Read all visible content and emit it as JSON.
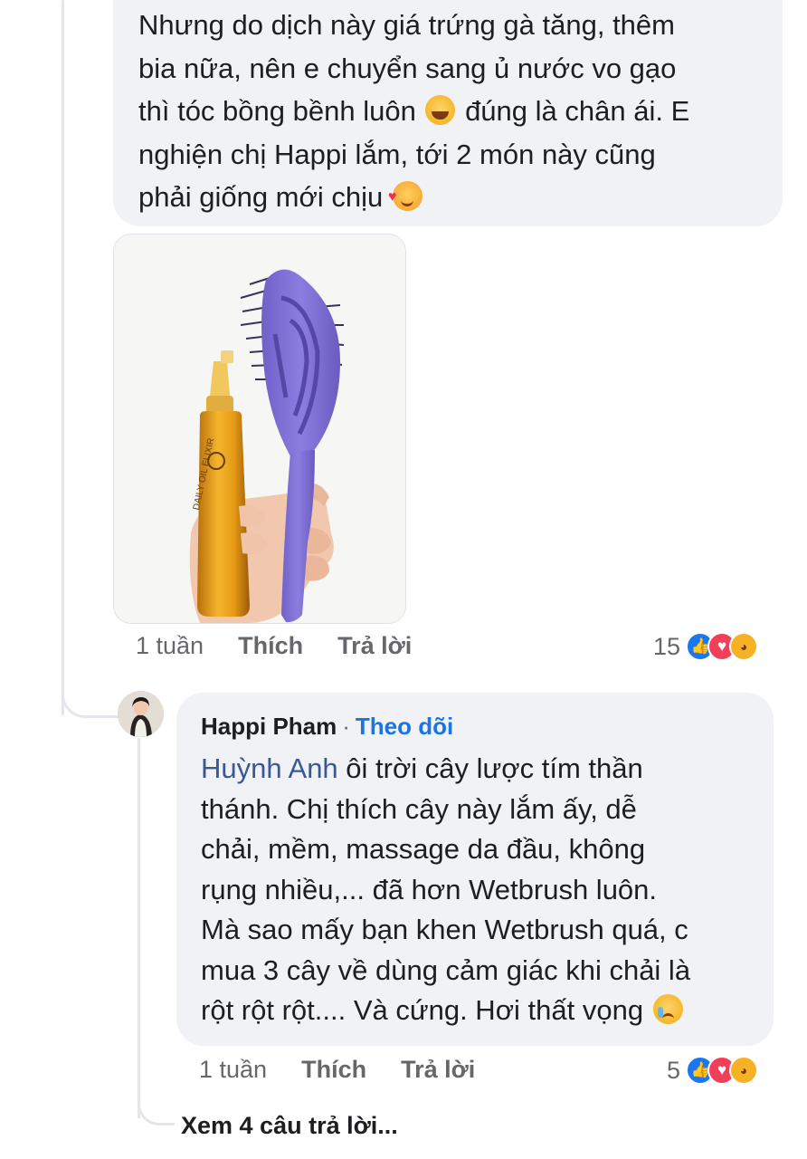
{
  "comment1": {
    "text_lines": [
      "Nhưng do dịch này giá trứng gà tăng, thêm",
      "bia nữa, nên e chuyển sang ủ nước vo gạo",
      "thì tóc bồng bềnh luôn",
      "đúng là chân ái. E",
      "nghiện chị Happi lắm, tới 2 món này cũng",
      "phải giống mới chịu"
    ],
    "emoji_1": "laughing-face-icon",
    "emoji_2": "smiling-face-with-hearts-icon",
    "photo_alt": "hand holding purple hairbrush and oil elixir bottle",
    "bottle_label": "DAILY OIL ELIXIR",
    "time": "1 tuần",
    "like_label": "Thích",
    "reply_label": "Trả lời",
    "reaction_count": "15",
    "reactions": [
      "like-icon",
      "love-icon",
      "haha-icon"
    ]
  },
  "reply1": {
    "author": "Happi Pham",
    "separator": "·",
    "follow_label": "Theo dõi",
    "mention": "Huỳnh Anh",
    "text_after_mention": " ôi trời cây lược tím thần",
    "text_lines": [
      "thánh. Chị thích cây này lắm ấy, dễ",
      "chải, mềm, massage da đầu, không",
      "rụng nhiều,... đã hơn Wetbrush luôn.",
      "Mà sao mấy bạn khen Wetbrush quá, c",
      "mua 3 cây về dùng cảm giác khi chải là",
      "rột rột rột.... Và cứng. Hơi thất vọng"
    ],
    "emoji": "crying-face-icon",
    "time": "1 tuần",
    "like_label": "Thích",
    "reply_label": "Trả lời",
    "reaction_count": "5",
    "reactions": [
      "like-icon",
      "love-icon",
      "haha-icon"
    ]
  },
  "view_more_replies": "Xem 4 câu trả lời...",
  "colors": {
    "bubble_bg": "#f0f2f5",
    "meta_text": "#65676b",
    "follow_link": "#1b74e4",
    "mention": "#385898",
    "like": "#1877f2",
    "love": "#f33e58",
    "haha": "#f7b125"
  }
}
